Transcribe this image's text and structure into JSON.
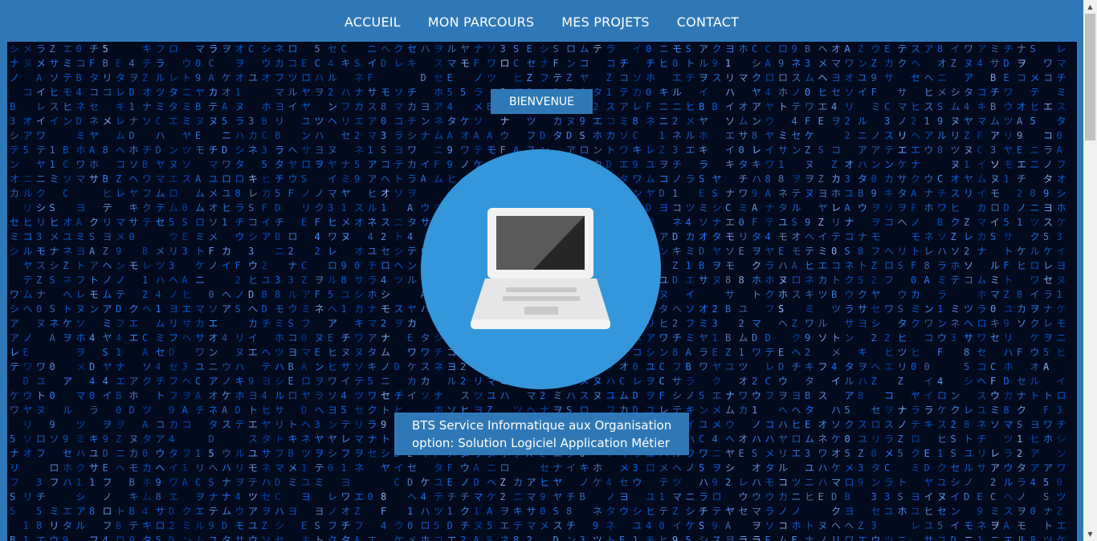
{
  "nav": {
    "items": [
      {
        "label": "ACCUEIL"
      },
      {
        "label": "MON PARCOURS"
      },
      {
        "label": "MES PROJETS"
      },
      {
        "label": "CONTACT"
      }
    ]
  },
  "hero": {
    "welcome": "BIENVENUE",
    "caption_line1": "BTS Service Informatique aux Organisation",
    "caption_line2": "option: Solution Logiciel Application Métier",
    "background_icon": "digital-rain-background",
    "center_icon": "laptop-icon"
  },
  "colors": {
    "brand_blue": "#2f78b8",
    "circle_blue": "#3497db",
    "matrix_dark": "#020a1e",
    "matrix_glyph": "#4a8cff"
  },
  "scrollbar": {
    "up_icon": "scroll-up-arrow-icon",
    "down_icon": "scroll-down-arrow-icon"
  }
}
